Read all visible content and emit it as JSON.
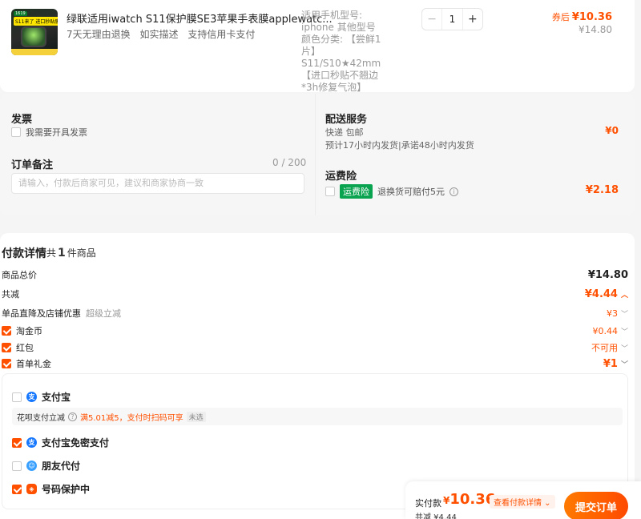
{
  "product": {
    "thumb_tag": "1619",
    "thumb_banner": "S11来了 进口秒贴膜",
    "title": "绿联适用iwatch S11保护膜SE3苹果手表膜applewatc...",
    "guarantees": [
      "7天无理由退换",
      "如实描述",
      "支持信用卡支付"
    ],
    "spec": "适用手机型号: iphone 其他型号 颜色分类: 【尝鲜1片】 S11/S10★42mm 【进口秒贴不翘边*3h修复气泡】",
    "qty_minus": "−",
    "qty": "1",
    "qty_plus": "+",
    "price_after_label": "券后",
    "price_after": "¥10.36",
    "price_original": "¥14.80"
  },
  "options": {
    "invoice_heading": "发票",
    "invoice_checkbox_label": "我需要开具发票",
    "note_heading": "订单备注",
    "note_count": "0 / 200",
    "note_placeholder": "请输入，付款后商家可见，建议和商家协商一致",
    "delivery_heading": "配送服务",
    "delivery_method": "快递 包邮",
    "delivery_estimate": "预计17小时内发货|承诺48小时内发货",
    "delivery_fee": "¥0",
    "insurance_heading": "运费险",
    "insurance_badge": "运费险",
    "insurance_text": "退换货可赔付5元",
    "insurance_fee": "¥2.18"
  },
  "details": {
    "title": "付款详情",
    "count_prefix": "共",
    "count": "1",
    "count_suffix": "件商品",
    "goods_total_label": "商品总价",
    "goods_total": "¥14.80",
    "discount_label": "共减",
    "discount_total": "¥4.44",
    "shop_discount_label": "单品直降及店铺优惠",
    "shop_discount_sub": "超级立减",
    "shop_discount": "¥3",
    "coins_label": "淘金币",
    "coins": "¥0.44",
    "redpack_label": "红包",
    "redpack": "不可用",
    "first_gift_label": "首单礼金",
    "first_gift": "¥1"
  },
  "payment": {
    "alipay": "支付宝",
    "huabei_label": "花呗支付立减",
    "huabei_promo": "满5.01减5，支付时扫码可享",
    "huabei_chip": "未选",
    "alipay_nopwd": "支付宝免密支付",
    "friend_pay": "朋友代付",
    "number_protect": "号码保护中"
  },
  "bottom": {
    "paid_label": "实付款",
    "paid_symbol": "¥",
    "paid_amount": "10.36",
    "view_detail": "查看付款详情 ⌄",
    "saved_label": "共减 ¥4.44",
    "submit": "提交订单"
  },
  "colors": {
    "accent": "#ff5000",
    "insurance": "#0aa34f",
    "alipay": "#1677ff"
  }
}
